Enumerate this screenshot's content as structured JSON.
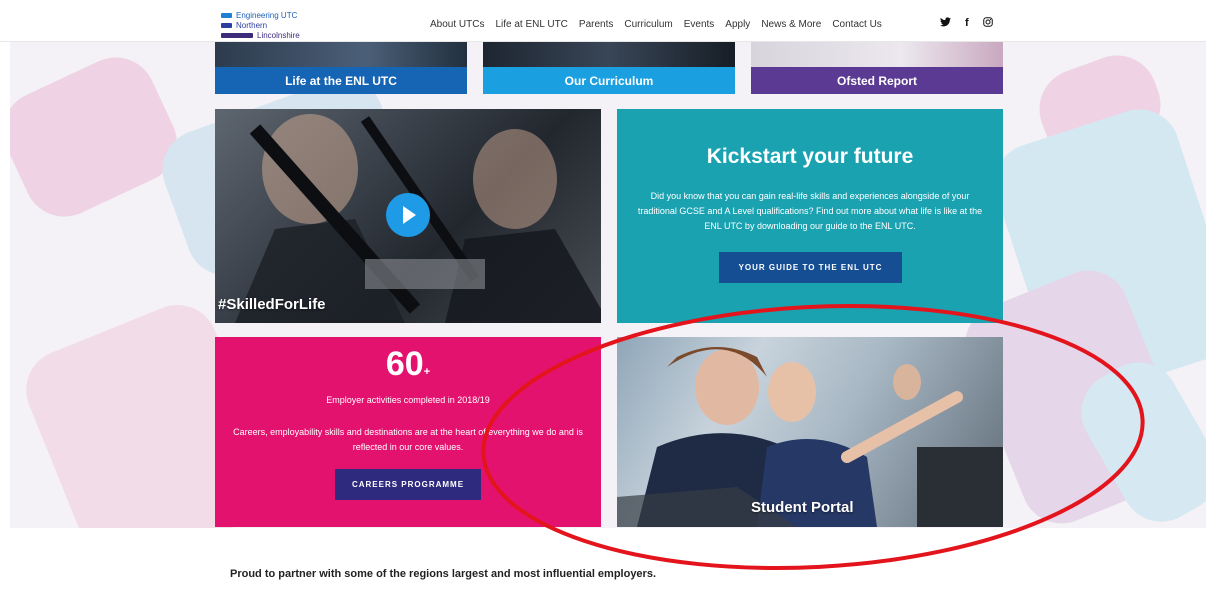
{
  "header": {
    "logo": {
      "line1": "Engineering UTC",
      "line2": "Northern",
      "line3": "Lincolnshire"
    },
    "nav": [
      "About UTCs",
      "Life at ENL UTC",
      "Parents",
      "Curriculum",
      "Events",
      "Apply",
      "News & More",
      "Contact Us"
    ],
    "social": [
      {
        "icon": "twitter-icon",
        "glyph": "🐦"
      },
      {
        "icon": "facebook-icon",
        "glyph": "f"
      },
      {
        "icon": "instagram-icon",
        "glyph": "◎"
      }
    ]
  },
  "top_tiles": [
    {
      "label": "Life at the ENL UTC",
      "color": "#1565b4"
    },
    {
      "label": "Our Curriculum",
      "color": "#1a9fe0"
    },
    {
      "label": "Ofsted Report",
      "color": "#5b3a93"
    }
  ],
  "video_tile": {
    "title": "#SkilledForLife"
  },
  "kickstart": {
    "title": "Kickstart your future",
    "text": "Did you know that you can gain real-life skills and experiences alongside of your traditional GCSE and A Level qualifications? Find out more about what life is like at the ENL UTC by downloading our guide to the ENL UTC.",
    "button": "YOUR GUIDE TO THE ENL UTC"
  },
  "careers": {
    "number": "60",
    "plus": "+",
    "subtitle": "Employer activities completed in 2018/19",
    "text": "Careers, employability skills and destinations are at the heart of everything we do and is reflected in our core values.",
    "button": "CAREERS PROGRAMME"
  },
  "portal_tile": {
    "title": "Student Portal"
  },
  "partner_text": "Proud to partner with some of the regions largest and most influential employers."
}
